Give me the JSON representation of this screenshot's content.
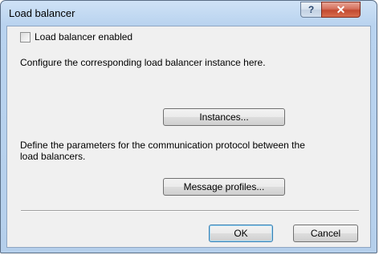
{
  "window": {
    "title": "Load balancer",
    "help_label": "?",
    "close_label": "✕"
  },
  "form": {
    "enable_label": "Load balancer enabled",
    "enable_checked": false,
    "instances_text": "Configure the corresponding load balancer instance here.",
    "instances_button": "Instances...",
    "protocol_text_line1": "Define the parameters for the communication protocol between the",
    "protocol_text_line2": "load balancers.",
    "profiles_button": "Message profiles..."
  },
  "buttons": {
    "ok": "OK",
    "cancel": "Cancel"
  }
}
